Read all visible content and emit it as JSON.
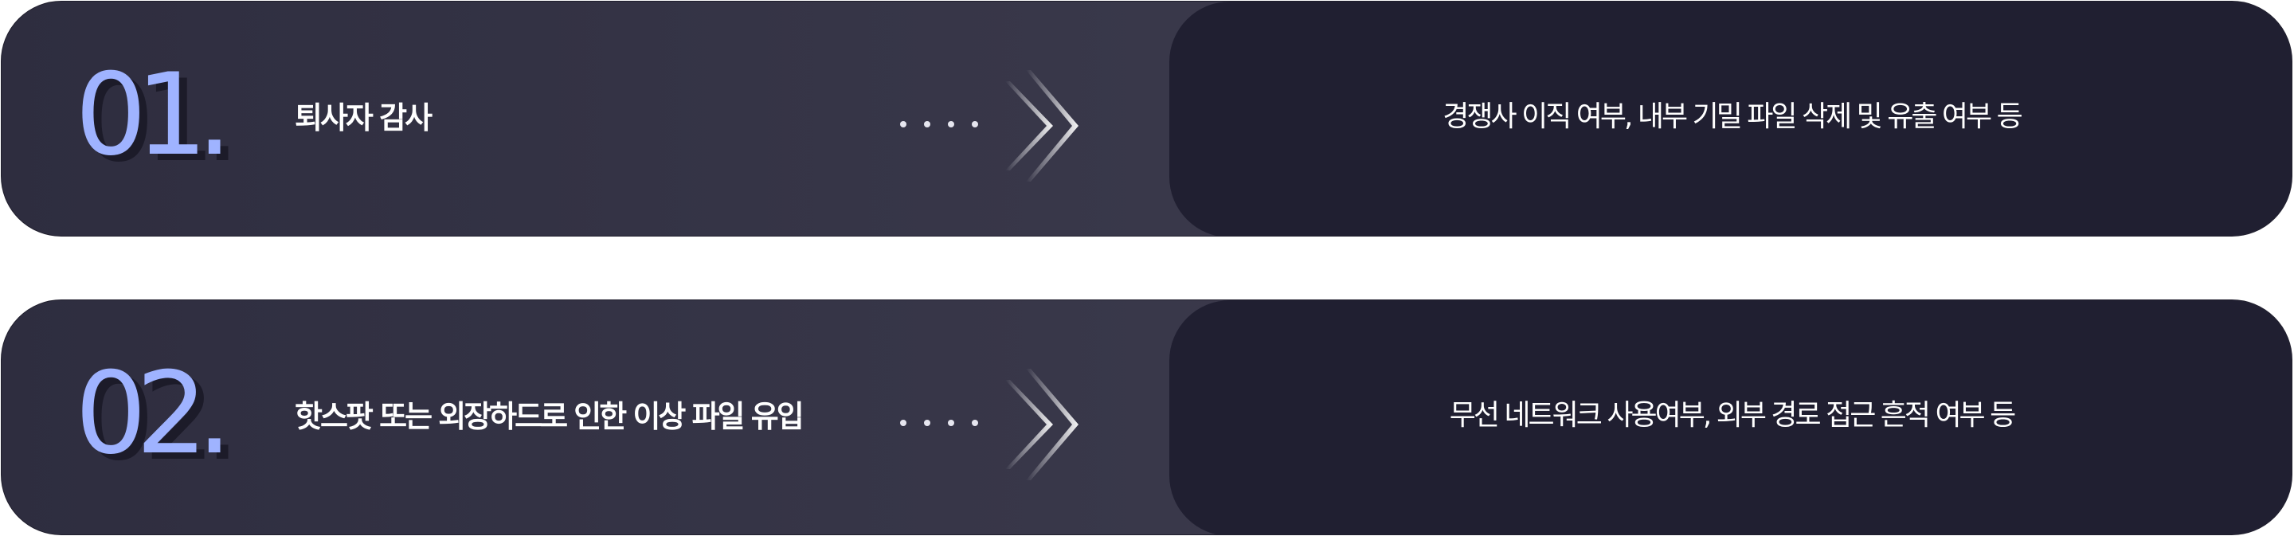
{
  "items": [
    {
      "number": "01.",
      "title": "퇴사자 감사",
      "description": "경쟁사 이직 여부, 내부 기밀 파일 삭제 및 유출 여부 등"
    },
    {
      "number": "02.",
      "title": "핫스팟 또는 외장하드로 인한 이상 파일 유입",
      "description": "무선 네트워크 사용여부, 외부 경로 접근 흔적 여부 등"
    }
  ],
  "colors": {
    "number": "#9fb3ff",
    "row_background": "#35344a",
    "description_panel": "#201f31",
    "text": "#ffffff"
  },
  "icons": [
    "dots-icon",
    "double-chevron-right-icon"
  ]
}
